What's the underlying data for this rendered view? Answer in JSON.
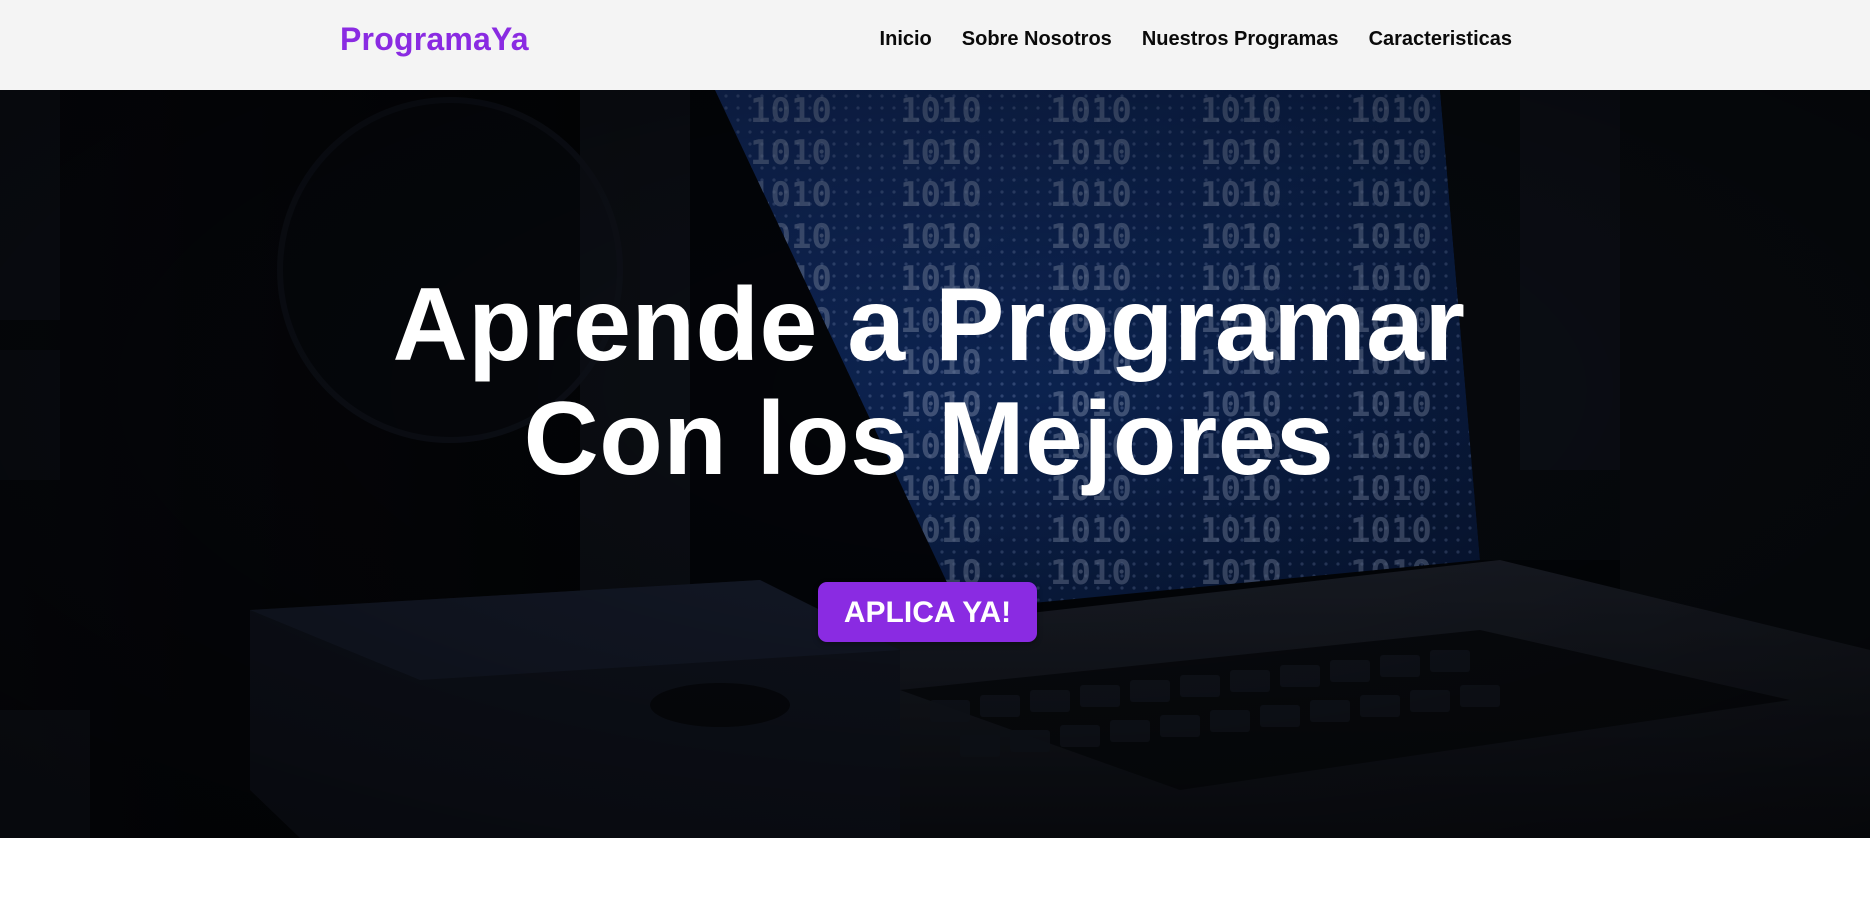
{
  "header": {
    "brand": "ProgramaYa",
    "nav": [
      {
        "label": "Inicio"
      },
      {
        "label": "Sobre Nosotros"
      },
      {
        "label": "Nuestros Programas"
      },
      {
        "label": "Caracteristicas"
      }
    ]
  },
  "hero": {
    "title_line1": "Aprende a Programar",
    "title_line2": "Con los Mejores",
    "cta_label": "APLICA YA!",
    "background": "laptop-binary-code-photo"
  },
  "colors": {
    "brand": "#8a2be2",
    "header_bg": "#f4f4f4",
    "hero_text": "#ffffff"
  }
}
